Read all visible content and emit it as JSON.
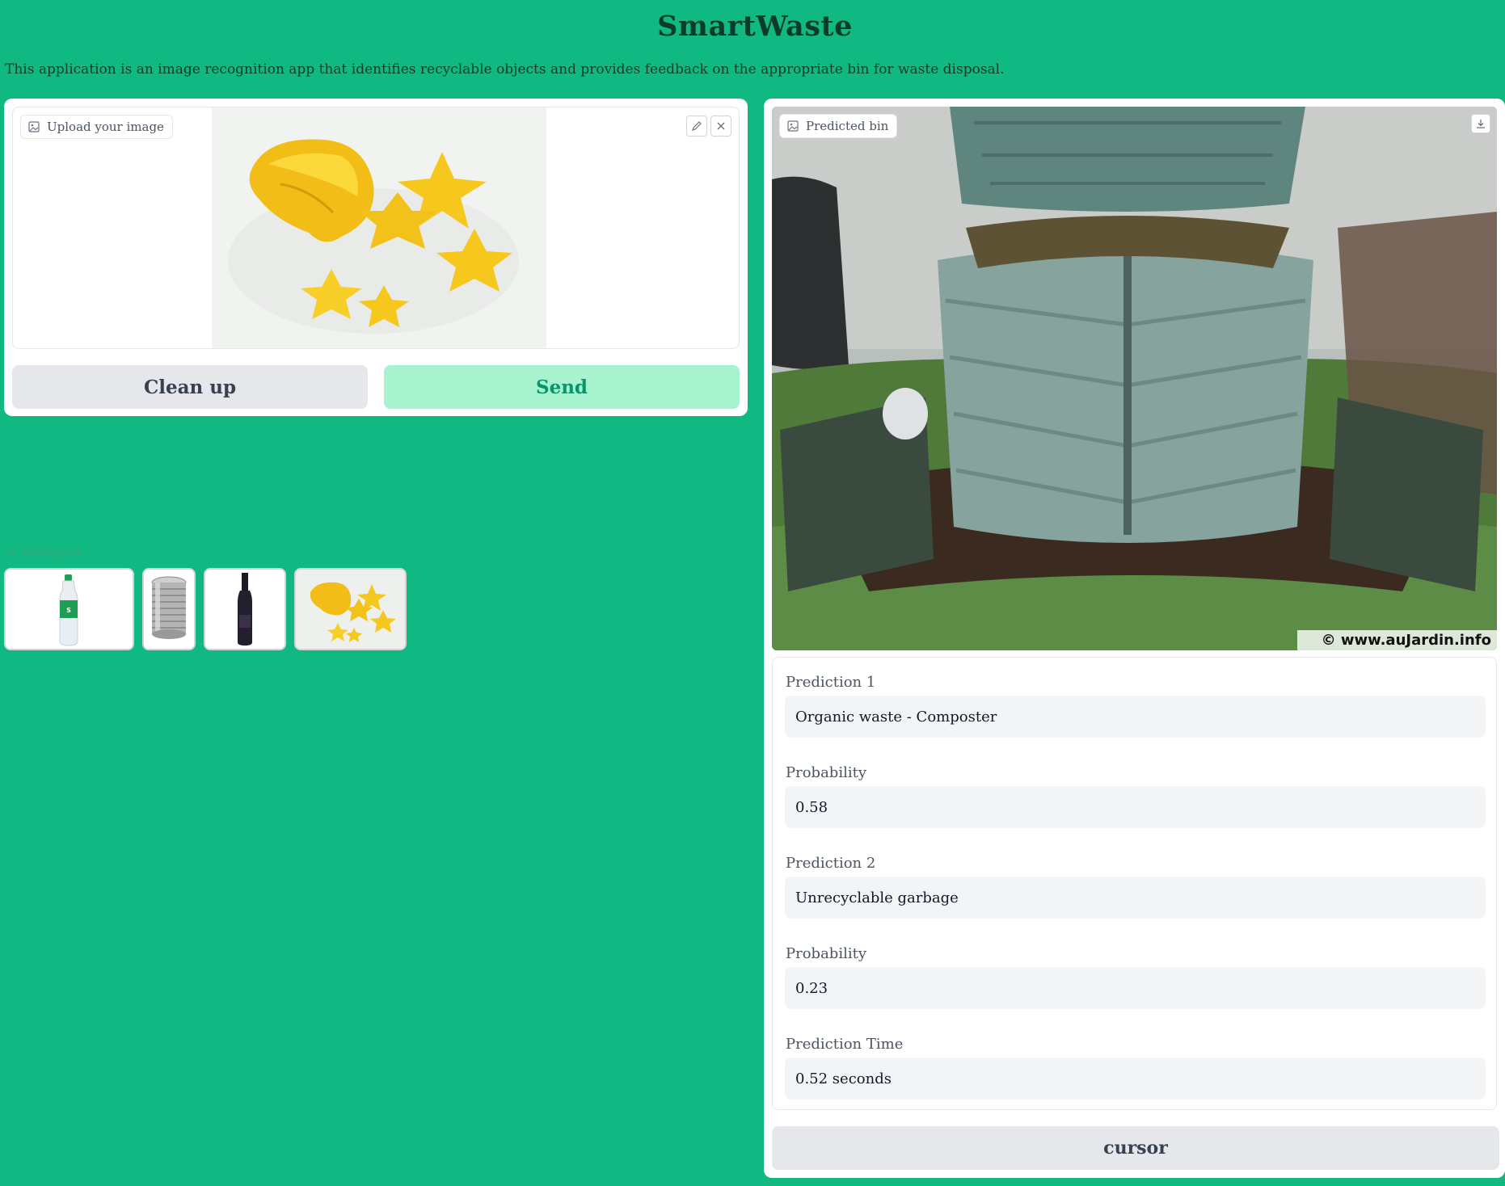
{
  "app": {
    "title": "SmartWaste",
    "description": "This application is an image recognition app that identifies recyclable objects and provides feedback on the appropriate bin for waste disposal."
  },
  "input": {
    "label": "Upload your image",
    "clean_label": "Clean up",
    "send_label": "Send"
  },
  "examples": {
    "label": "Examples",
    "items": [
      "plastic-bottle",
      "tin-can",
      "glass-wine-bottle",
      "starfruit"
    ]
  },
  "output": {
    "image_label": "Predicted bin",
    "watermark": "© www.auJardin.info",
    "fields": [
      {
        "label": "Prediction 1",
        "value": "Organic waste - Composter"
      },
      {
        "label": "Probability",
        "value": "0.58"
      },
      {
        "label": "Prediction 2",
        "value": "Unrecyclable garbage"
      },
      {
        "label": "Probability",
        "value": "0.23"
      },
      {
        "label": "Prediction Time",
        "value": "0.52 seconds"
      }
    ],
    "cursor_label": "cursor"
  },
  "colors": {
    "background": "#10b981",
    "send_bg": "#a7f3d0",
    "send_text": "#059669",
    "secondary_bg": "#e5e7eb"
  }
}
